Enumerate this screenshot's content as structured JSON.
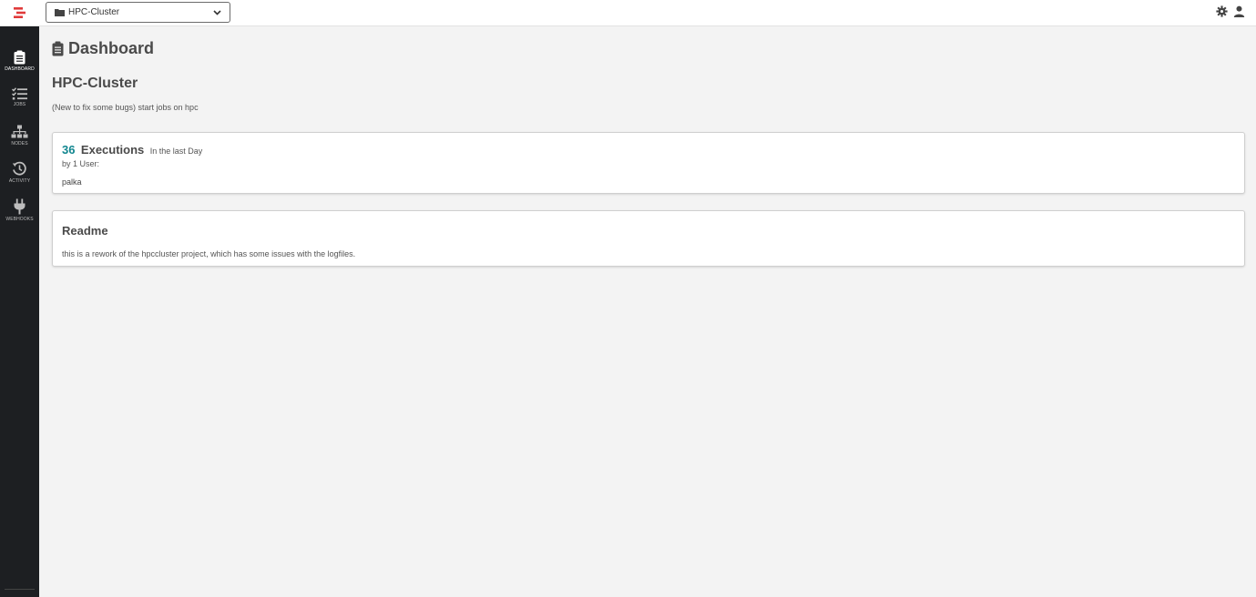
{
  "colors": {
    "accent": "#11868f",
    "sidebar_bg": "#1d1f22",
    "logo": "#e03a3a",
    "page_bg": "#f3f3f3"
  },
  "header": {
    "project_select_value": "HPC-Cluster",
    "icons": [
      "settings-gear-icon",
      "user-icon"
    ]
  },
  "sidebar": {
    "items": [
      {
        "label": "DASHBOARD",
        "icon": "clipboard-icon",
        "active": true
      },
      {
        "label": "JOBS",
        "icon": "tasks-icon"
      },
      {
        "label": "NODES",
        "icon": "sitemap-icon"
      },
      {
        "label": "ACTIVITY",
        "icon": "history-icon"
      },
      {
        "label": "WEBHOOKS",
        "icon": "plug-icon"
      }
    ]
  },
  "main": {
    "page_title": "Dashboard",
    "project_name": "HPC-Cluster",
    "project_description": "(New to fix some bugs) start jobs on hpc",
    "executions": {
      "count": "36",
      "label": "Executions",
      "period": "In the last Day",
      "by_users": "by 1 User:",
      "users": [
        "palka"
      ]
    },
    "readme": {
      "title": "Readme",
      "body": "this is a rework of the hpccluster project, which has some issues with the logfiles."
    }
  }
}
